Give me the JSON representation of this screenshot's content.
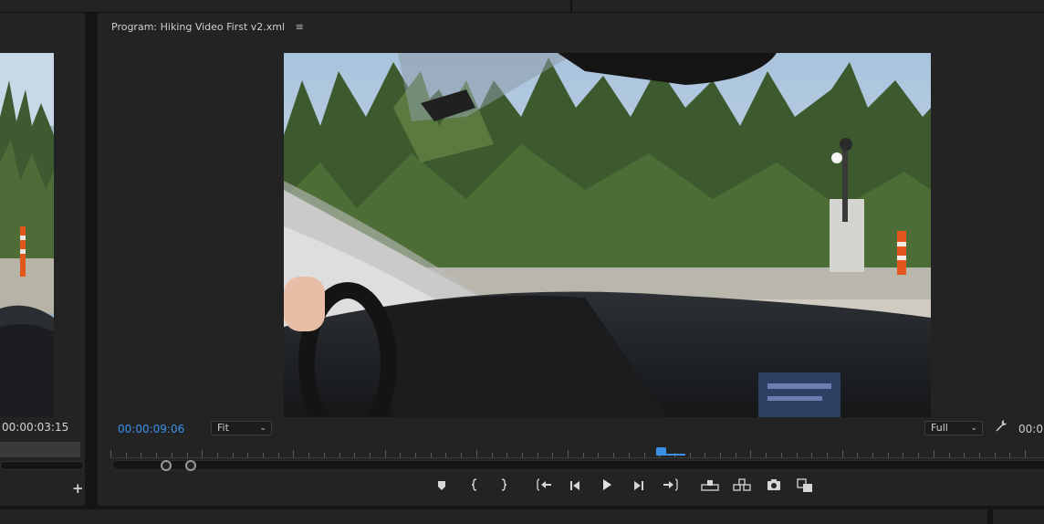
{
  "source_monitor": {
    "timecode": "00:00:03:15",
    "add_icon": "plus-icon"
  },
  "program_monitor": {
    "title": "Program: Hiking Video First v2.xml",
    "menu_icon": "≡",
    "timecode": "00:00:09:06",
    "zoom_select": {
      "value": "Fit"
    },
    "quality_select": {
      "value": "Full"
    },
    "settings_icon": "wrench-icon",
    "duration_timecode": "00:0",
    "accent_color": "#3b90e8"
  },
  "transport_controls": [
    {
      "icon": "add-marker-icon",
      "label": "Add Marker"
    },
    {
      "icon": "mark-in-icon",
      "label": "Mark In"
    },
    {
      "icon": "mark-out-icon",
      "label": "Mark Out"
    },
    {
      "icon": "go-to-in-icon",
      "label": "Go to In"
    },
    {
      "icon": "step-back-icon",
      "label": "Step Back 1 Frame"
    },
    {
      "icon": "play-icon",
      "label": "Play-Stop Toggle"
    },
    {
      "icon": "step-forward-icon",
      "label": "Step Forward 1 Frame"
    },
    {
      "icon": "go-to-out-icon",
      "label": "Go to Out"
    },
    {
      "icon": "lift-icon",
      "label": "Lift"
    },
    {
      "icon": "extract-icon",
      "label": "Extract"
    },
    {
      "icon": "camera-icon",
      "label": "Export Frame"
    },
    {
      "icon": "comparison-view-icon",
      "label": "Comparison View"
    }
  ]
}
